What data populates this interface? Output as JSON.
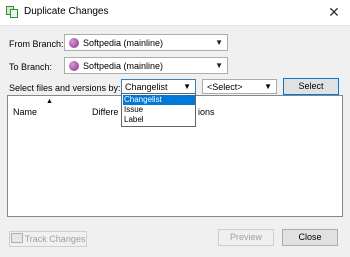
{
  "window": {
    "title": "Duplicate Changes",
    "close_glyph": "✕"
  },
  "from_branch": {
    "label": "From Branch:",
    "value": "Softpedia (mainline)"
  },
  "to_branch": {
    "label": "To Branch:",
    "value": "Softpedia (mainline)"
  },
  "select_by": {
    "label": "Select files and versions by:",
    "value": "Changelist",
    "options": [
      "Changelist",
      "Issue",
      "Label"
    ],
    "secondary_value": "<Select>",
    "select_button": "Select"
  },
  "list": {
    "columns": [
      "Name",
      "Differe",
      "ions"
    ]
  },
  "footer": {
    "track_changes": "Track Changes",
    "preview": "Preview",
    "close": "Close"
  },
  "colors": {
    "accent": "#0078d7"
  }
}
